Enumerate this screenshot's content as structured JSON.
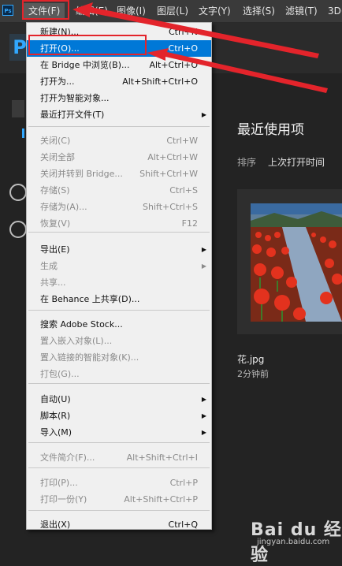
{
  "app": {
    "logo_text": "Ps"
  },
  "menubar": {
    "file": "文件(F)",
    "edit": "编辑(E)",
    "image": "图像(I)",
    "layer": "图层(L)",
    "type": "文字(Y)",
    "select": "选择(S)",
    "filter": "滤镜(T)",
    "threed": "3D(D"
  },
  "home": {
    "badge": "P",
    "recent_title": "最近使用项",
    "sort_label": "排序",
    "sort_value": "上次打开时间",
    "file_name": "花.jpg",
    "file_time": "2分钟前"
  },
  "file_menu": {
    "items": [
      {
        "label": "新建(N)...",
        "shortcut": "Ctrl+N",
        "disabled": false
      },
      {
        "label": "打开(O)...",
        "shortcut": "Ctrl+O",
        "disabled": false,
        "highlighted": true
      },
      {
        "label": "在 Bridge 中浏览(B)...",
        "shortcut": "Alt+Ctrl+O",
        "disabled": false
      },
      {
        "label": "打开为...",
        "shortcut": "Alt+Shift+Ctrl+O",
        "disabled": false
      },
      {
        "label": "打开为智能对象...",
        "shortcut": "",
        "disabled": false
      },
      {
        "label": "最近打开文件(T)",
        "shortcut": "",
        "disabled": false,
        "submenu": true
      },
      {
        "label": "关闭(C)",
        "shortcut": "Ctrl+W",
        "disabled": true
      },
      {
        "label": "关闭全部",
        "shortcut": "Alt+Ctrl+W",
        "disabled": true
      },
      {
        "label": "关闭并转到 Bridge...",
        "shortcut": "Shift+Ctrl+W",
        "disabled": true
      },
      {
        "label": "存储(S)",
        "shortcut": "Ctrl+S",
        "disabled": true
      },
      {
        "label": "存储为(A)...",
        "shortcut": "Shift+Ctrl+S",
        "disabled": true
      },
      {
        "label": "恢复(V)",
        "shortcut": "F12",
        "disabled": true
      },
      {
        "label": "导出(E)",
        "shortcut": "",
        "disabled": false,
        "submenu": true
      },
      {
        "label": "生成",
        "shortcut": "",
        "disabled": true,
        "submenu": true
      },
      {
        "label": "共享...",
        "shortcut": "",
        "disabled": true
      },
      {
        "label": "在 Behance 上共享(D)...",
        "shortcut": "",
        "disabled": false
      },
      {
        "label": "搜索 Adobe Stock...",
        "shortcut": "",
        "disabled": false
      },
      {
        "label": "置入嵌入对象(L)...",
        "shortcut": "",
        "disabled": true
      },
      {
        "label": "置入链接的智能对象(K)...",
        "shortcut": "",
        "disabled": true
      },
      {
        "label": "打包(G)...",
        "shortcut": "",
        "disabled": true
      },
      {
        "label": "自动(U)",
        "shortcut": "",
        "disabled": false,
        "submenu": true
      },
      {
        "label": "脚本(R)",
        "shortcut": "",
        "disabled": false,
        "submenu": true
      },
      {
        "label": "导入(M)",
        "shortcut": "",
        "disabled": false,
        "submenu": true
      },
      {
        "label": "文件简介(F)...",
        "shortcut": "Alt+Shift+Ctrl+I",
        "disabled": true
      },
      {
        "label": "打印(P)...",
        "shortcut": "Ctrl+P",
        "disabled": true
      },
      {
        "label": "打印一份(Y)",
        "shortcut": "Alt+Shift+Ctrl+P",
        "disabled": true
      },
      {
        "label": "退出(X)",
        "shortcut": "Ctrl+Q",
        "disabled": false
      }
    ]
  },
  "watermark": {
    "text": "Bai du 经验",
    "url": "jingyan.baidu.com"
  },
  "colors": {
    "highlight": "#0078d7",
    "annotation": "#e3242b",
    "brand": "#31a8ff"
  }
}
